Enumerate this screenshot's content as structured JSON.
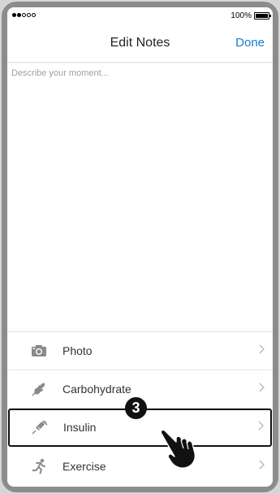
{
  "status_bar": {
    "battery_percent": "100%"
  },
  "nav": {
    "title": "Edit Notes",
    "done_label": "Done"
  },
  "notes": {
    "placeholder": "Describe your moment...",
    "value": ""
  },
  "menu": {
    "items": [
      {
        "label": "Photo",
        "icon": "camera-icon"
      },
      {
        "label": "Carbohydrate",
        "icon": "wheat-icon"
      },
      {
        "label": "Insulin",
        "icon": "syringe-icon"
      },
      {
        "label": "Exercise",
        "icon": "running-icon"
      }
    ]
  },
  "annotation": {
    "step_number": "3",
    "highlighted_item": "Insulin",
    "pointer_icon": "hand-pointer-icon"
  },
  "colors": {
    "accent": "#1a7ac9",
    "icon_gray": "#8a8a8a",
    "frame": "#8c8c8c"
  }
}
